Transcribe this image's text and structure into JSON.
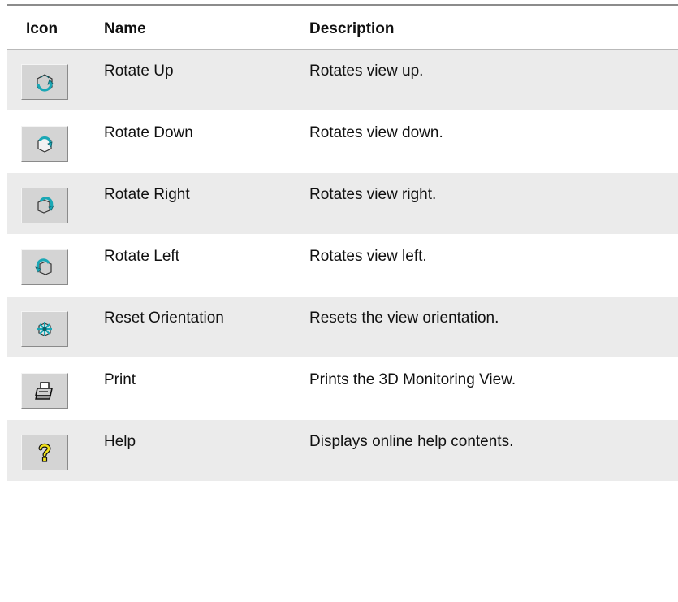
{
  "table": {
    "headers": {
      "icon": "Icon",
      "name": "Name",
      "description": "Description"
    },
    "rows": [
      {
        "icon": "rotate-up-icon",
        "name": "Rotate Up",
        "description": "Rotates view up."
      },
      {
        "icon": "rotate-down-icon",
        "name": "Rotate Down",
        "description": "Rotates view down."
      },
      {
        "icon": "rotate-right-icon",
        "name": "Rotate Right",
        "description": "Rotates view right."
      },
      {
        "icon": "rotate-left-icon",
        "name": "Rotate Left",
        "description": "Rotates view left."
      },
      {
        "icon": "reset-orientation-icon",
        "name": "Reset Orientation",
        "description": "Resets the view orientation."
      },
      {
        "icon": "print-icon",
        "name": "Print",
        "description": "Prints the 3D Monitoring View."
      },
      {
        "icon": "help-icon",
        "name": "Help",
        "description": "Displays online help contents."
      }
    ]
  },
  "colors": {
    "shaded_row": "#ebebeb",
    "button_face": "#d4d4d4",
    "icon_teal": "#1aa7b5",
    "help_yellow": "#f2e21a"
  }
}
